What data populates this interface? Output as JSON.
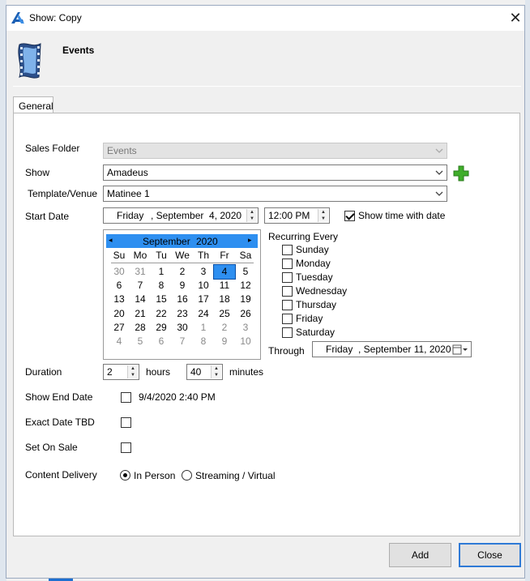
{
  "window": {
    "title": "Show: Copy"
  },
  "header": {
    "title": "Events"
  },
  "tabs": [
    {
      "label": "General"
    }
  ],
  "form": {
    "sales_folder": {
      "label": "Sales Folder",
      "value": "Events"
    },
    "show": {
      "label": "Show",
      "value": "Amadeus"
    },
    "template_venue": {
      "label": "Template/Venue",
      "value": "Matinee 1"
    },
    "start_date": {
      "label": "Start Date",
      "day": "Friday",
      "rest": ", September  4, 2020",
      "time": "12:00 PM"
    },
    "show_time_with_date": {
      "label": "Show time with date",
      "checked": true
    },
    "recurring": {
      "label": "Recurring Every",
      "days": [
        "Sunday",
        "Monday",
        "Tuesday",
        "Wednesday",
        "Thursday",
        "Friday",
        "Saturday"
      ],
      "through_label": "Through",
      "through_day": "Friday",
      "through_rest": ", September 11, 2020"
    },
    "duration": {
      "label": "Duration",
      "hours": "2",
      "hours_label": "hours",
      "minutes": "40",
      "minutes_label": "minutes"
    },
    "show_end_date": {
      "label": "Show End Date",
      "value": "9/4/2020 2:40 PM"
    },
    "exact_date_tbd": {
      "label": "Exact Date TBD"
    },
    "set_on_sale": {
      "label": "Set On Sale"
    },
    "content_delivery": {
      "label": "Content Delivery",
      "options": [
        "In Person",
        "Streaming / Virtual"
      ],
      "selected": 0
    }
  },
  "calendar": {
    "month_label": "September",
    "year_label": "2020",
    "dow": [
      "Su",
      "Mo",
      "Tu",
      "We",
      "Th",
      "Fr",
      "Sa"
    ],
    "weeks": [
      [
        "30",
        "31",
        "1",
        "2",
        "3",
        "4",
        "5"
      ],
      [
        "6",
        "7",
        "8",
        "9",
        "10",
        "11",
        "12"
      ],
      [
        "13",
        "14",
        "15",
        "16",
        "17",
        "18",
        "19"
      ],
      [
        "20",
        "21",
        "22",
        "23",
        "24",
        "25",
        "26"
      ],
      [
        "27",
        "28",
        "29",
        "30",
        "1",
        "2",
        "3"
      ],
      [
        "4",
        "5",
        "6",
        "7",
        "8",
        "9",
        "10"
      ]
    ],
    "selected_day": "4"
  },
  "buttons": {
    "add": "Add",
    "close": "Close"
  },
  "colors": {
    "accent": "#2e8ff0",
    "add_icon": "#3fae2a"
  }
}
